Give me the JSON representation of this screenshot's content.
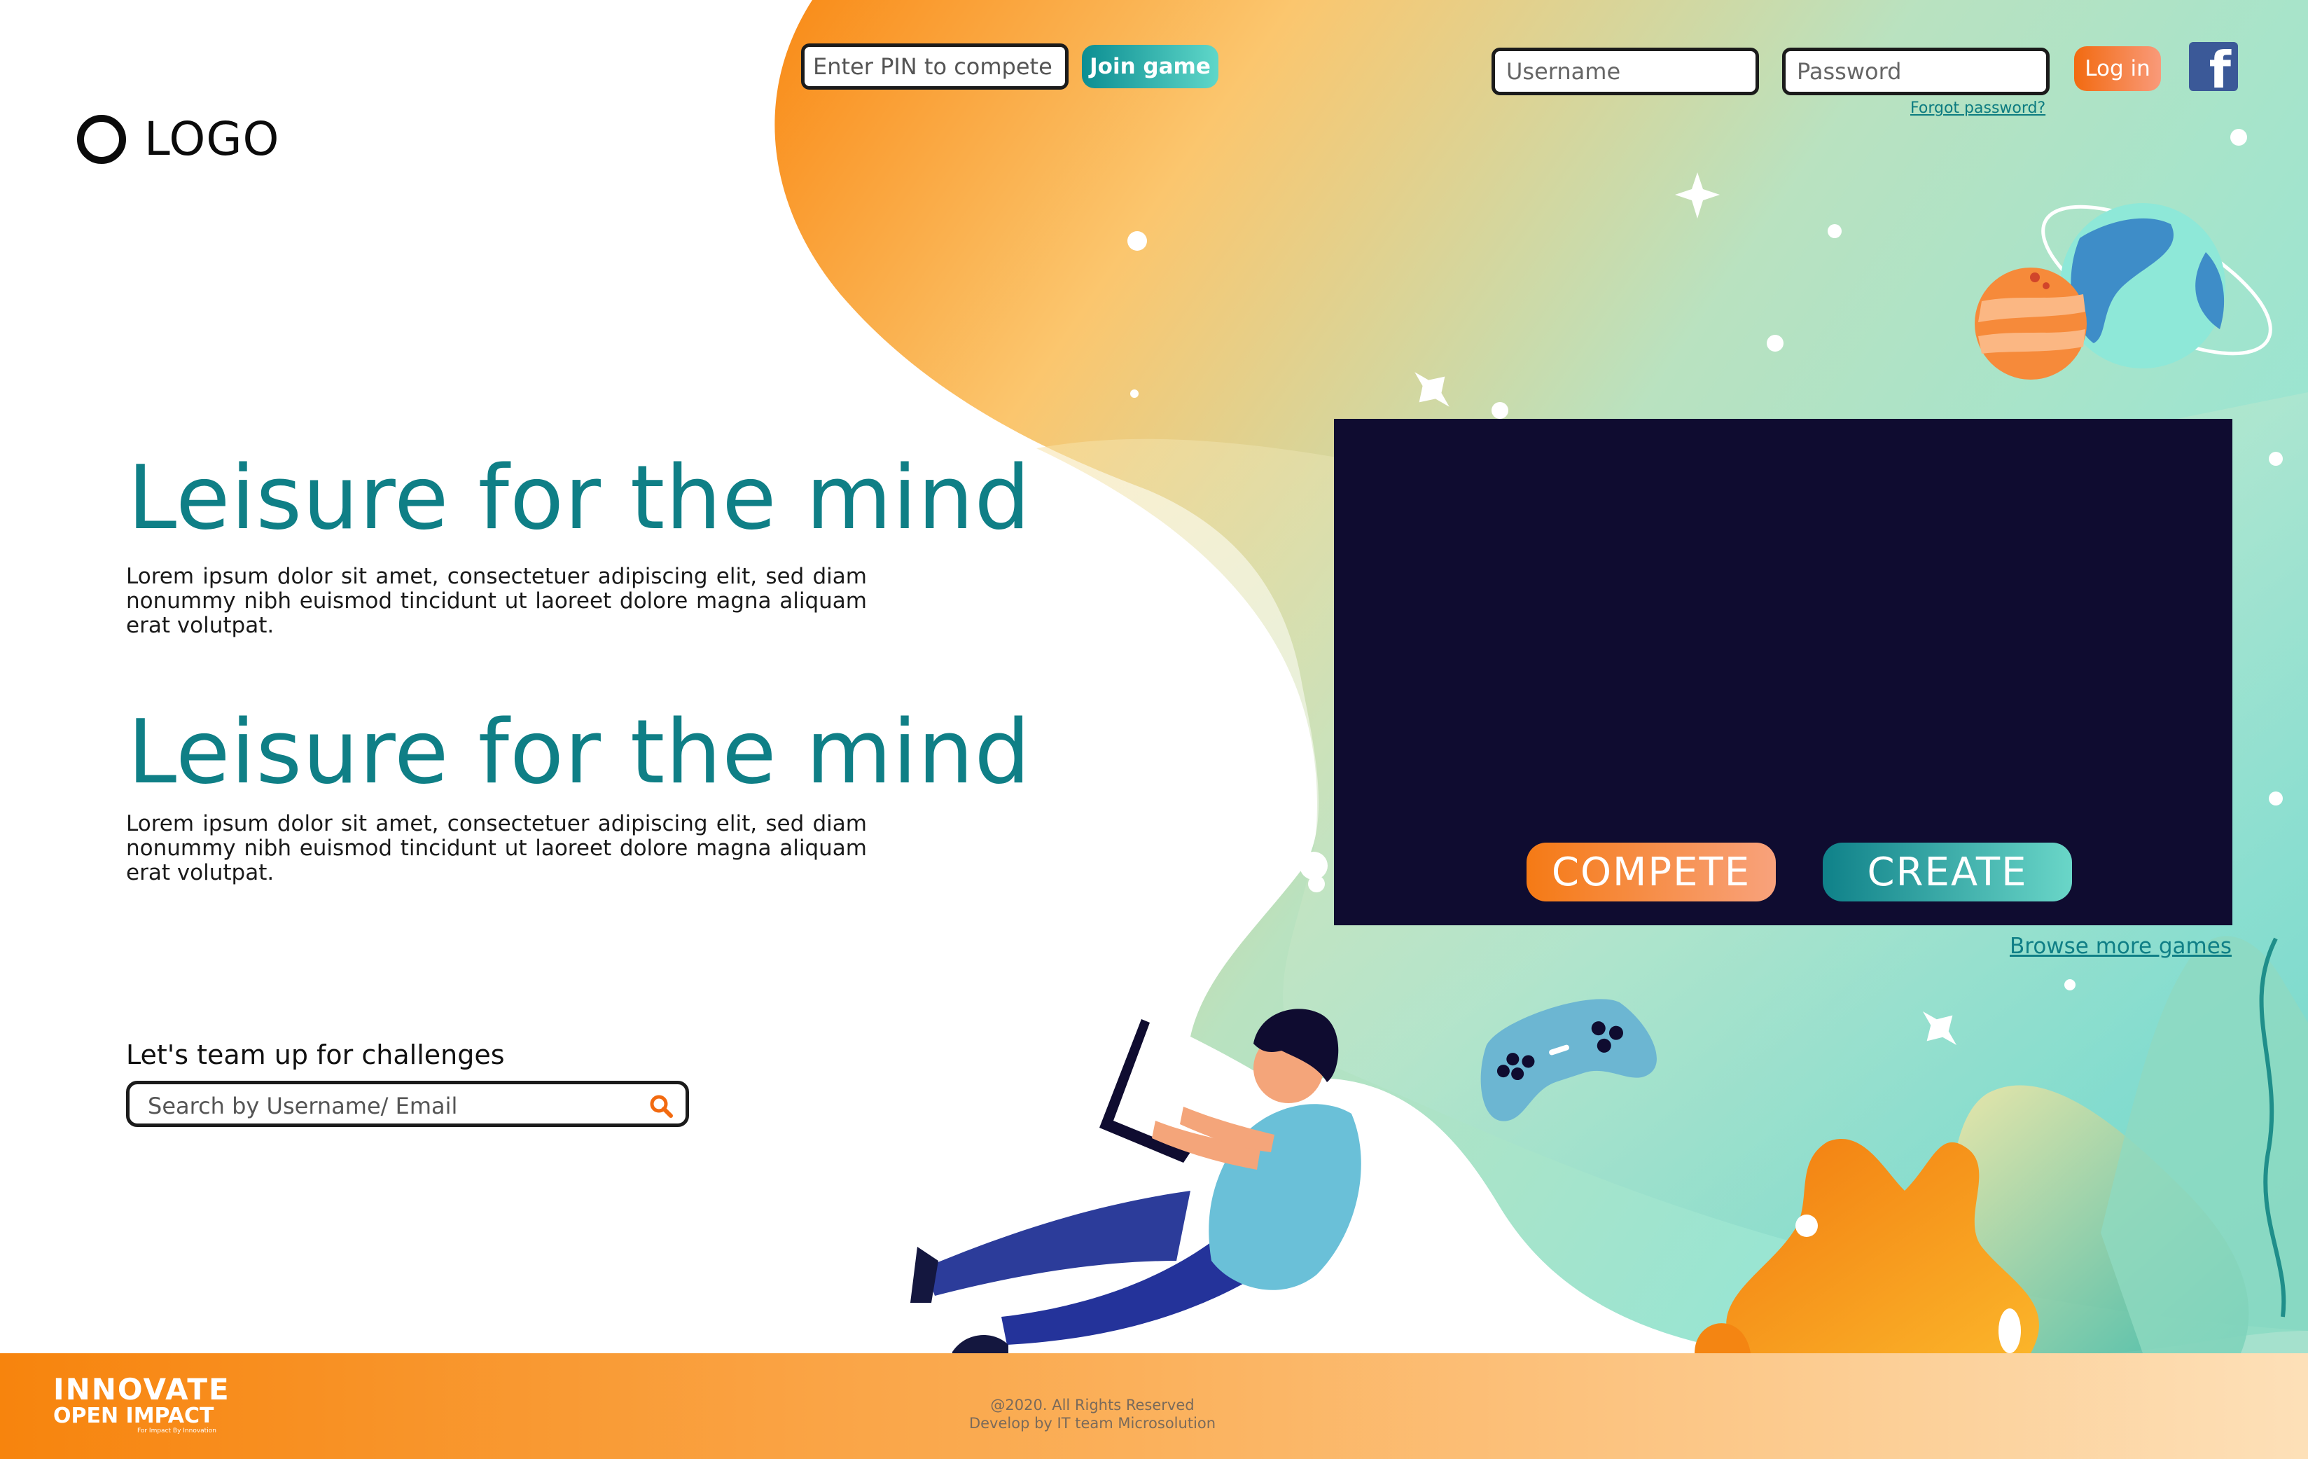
{
  "header": {
    "logo_text": "LOGO",
    "pin_placeholder": "Enter PIN to compete",
    "join_label": "Join game",
    "username_placeholder": "Username",
    "password_placeholder": "Password",
    "forgot_label": "Forgot password?",
    "login_label": "Log in",
    "facebook_glyph": "f"
  },
  "hero": {
    "sections": [
      {
        "title": "Leisure for the mind",
        "text": "Lorem ipsum dolor sit amet, consectetuer adipiscing elit, sed diam nonummy nibh euismod tincidunt ut laoreet dolore magna aliquam erat volutpat."
      },
      {
        "title": "Leisure for the mind",
        "text": "Lorem ipsum dolor sit amet, consectetuer adipiscing elit, sed diam nonummy nibh euismod tincidunt ut laoreet dolore magna aliquam erat volutpat."
      }
    ]
  },
  "team": {
    "label": "Let's team up for challenges",
    "search_placeholder": "Search by Username/ Email"
  },
  "game_panel": {
    "compete_label": "COMPETE",
    "create_label": "CREATE",
    "browse_label": "Browse more games"
  },
  "footer": {
    "brand_line1": "INNOVATE",
    "brand_line2": "OPEN IMPACT",
    "brand_tagline": "For Impact By Innovation",
    "copyright": "@2020. All Rights Reserved",
    "credit": "Develop by IT team Microsolution"
  },
  "colors": {
    "teal": "#0f7f86",
    "orange": "#f57a15",
    "panel": "#0f0c30",
    "facebook": "#3b5998"
  },
  "icons": [
    "logo-circle-icon",
    "facebook-icon",
    "search-icon",
    "planet-icon",
    "gamepad-icon",
    "star-icon"
  ]
}
